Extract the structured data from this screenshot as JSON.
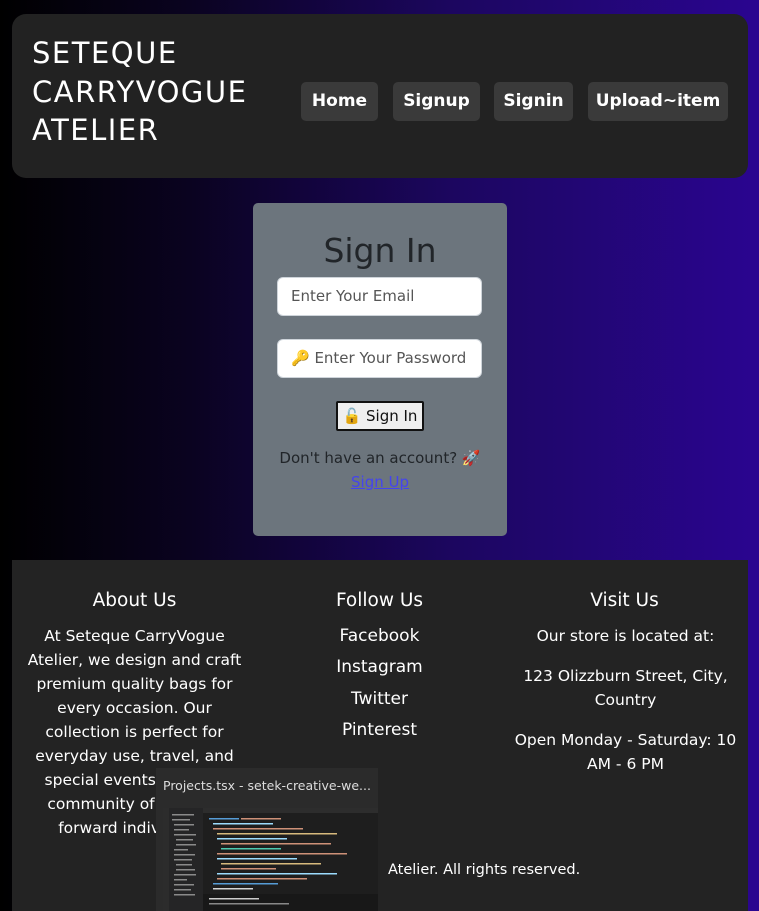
{
  "header": {
    "brand_line1": "SETEQUE",
    "brand_line2": "CARRYVOGUE",
    "brand_line3": "ATELIER",
    "nav": [
      {
        "label": "Home"
      },
      {
        "label": "Signup"
      },
      {
        "label": "Signin"
      },
      {
        "label": "Upload~item"
      }
    ]
  },
  "signin": {
    "title": "Sign In",
    "email_placeholder": "Enter Your Email",
    "password_placeholder": "🔑 Enter Your Password",
    "button_label": "🔓 Sign In",
    "no_account_text": "Don't have an account? 🚀",
    "signup_link": "Sign Up"
  },
  "footer": {
    "about": {
      "title": "About Us",
      "text": "At Seteque CarryVogue Atelier, we design and craft premium quality bags for every occasion. Our collection is perfect for everyday use, travel, and special events. Join our community of fashion-forward individuals."
    },
    "follow": {
      "title": "Follow Us",
      "links": [
        "Facebook",
        "Instagram",
        "Twitter",
        "Pinterest"
      ]
    },
    "visit": {
      "title": "Visit Us",
      "line1": "Our store is located at:",
      "line2": "123 Olizzburn Street, City, Country",
      "line3": "Open Monday - Saturday: 10 AM - 6 PM"
    },
    "copyright_visible": "Atelier. All rights reserved."
  },
  "window_preview": {
    "title": "Projects.tsx - setek-creative-we..."
  },
  "colors": {
    "header_bg": "#222222",
    "card_bg": "#6c757d",
    "footer_bg": "#232323",
    "link": "#4444ee",
    "gradient_end": "#2a0590"
  }
}
